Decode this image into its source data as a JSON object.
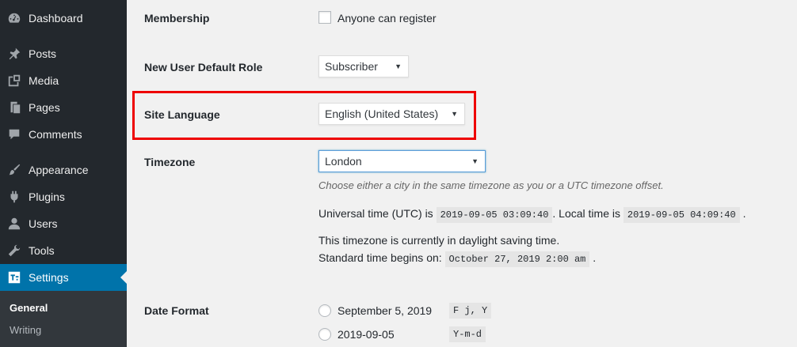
{
  "sidebar": {
    "items": [
      {
        "label": "Dashboard",
        "icon": "dashboard-icon"
      },
      {
        "label": "Posts",
        "icon": "pin-icon"
      },
      {
        "label": "Media",
        "icon": "media-icon"
      },
      {
        "label": "Pages",
        "icon": "pages-icon"
      },
      {
        "label": "Comments",
        "icon": "comment-icon"
      },
      {
        "label": "Appearance",
        "icon": "brush-icon"
      },
      {
        "label": "Plugins",
        "icon": "plug-icon"
      },
      {
        "label": "Users",
        "icon": "user-icon"
      },
      {
        "label": "Tools",
        "icon": "wrench-icon"
      },
      {
        "label": "Settings",
        "icon": "settings-icon"
      }
    ],
    "submenu": [
      "General",
      "Writing"
    ],
    "active_color": "#0073aa"
  },
  "settings": {
    "membership": {
      "label": "Membership",
      "checkbox_label": "Anyone can register",
      "checked": false
    },
    "default_role": {
      "label": "New User Default Role",
      "value": "Subscriber"
    },
    "site_language": {
      "label": "Site Language",
      "value": "English (United States)"
    },
    "timezone": {
      "label": "Timezone",
      "value": "London",
      "description": "Choose either a city in the same timezone as you or a UTC timezone offset.",
      "utc_prefix": "Universal time (UTC) is",
      "utc_time": "2019-09-05 03:09:40",
      "local_prefix": ". Local time is",
      "local_time": "2019-09-05 04:09:40",
      "end_period": ".",
      "dst_note": "This timezone is currently in daylight saving time.",
      "standard_prefix": "Standard time begins on:",
      "standard_time": "October 27, 2019 2:00 am",
      "standard_end": "."
    },
    "date_format": {
      "label": "Date Format",
      "options": [
        {
          "display": "September 5, 2019",
          "code": "F j, Y"
        },
        {
          "display": "2019-09-05",
          "code": "Y-m-d"
        }
      ]
    }
  },
  "highlight_color": "#e00000"
}
